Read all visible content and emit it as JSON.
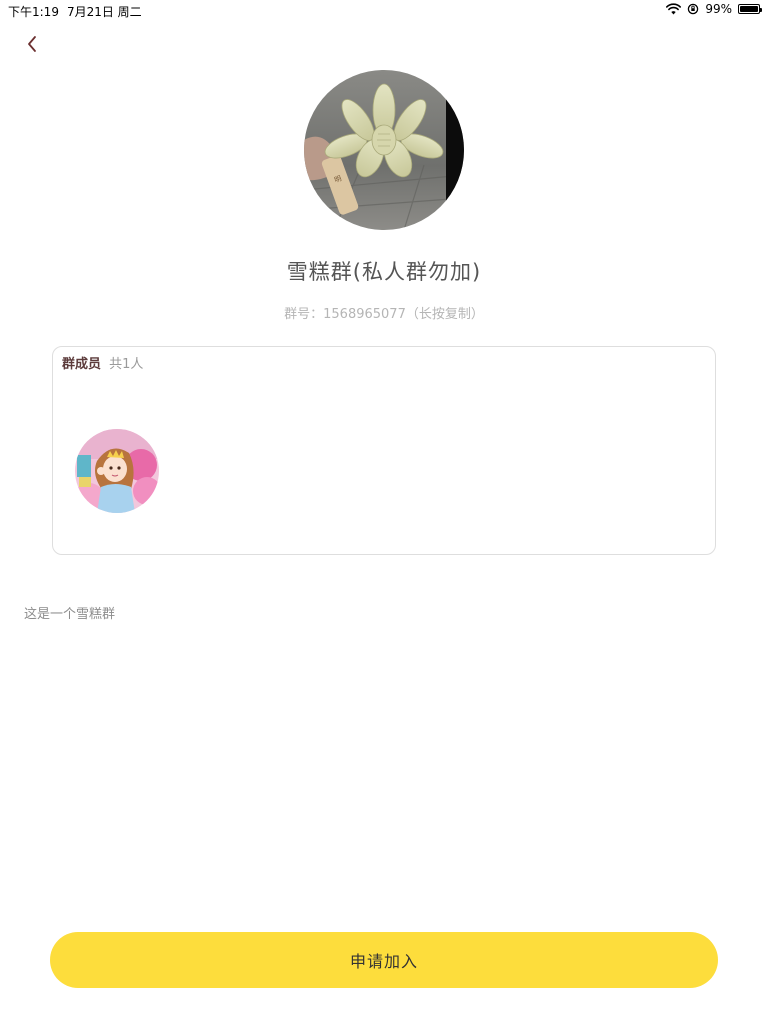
{
  "status_bar": {
    "time": "下午1:19",
    "date": "7月21日 周二",
    "battery_percent": "99%",
    "battery_level": 0.99
  },
  "header": {
    "back_icon": "chevron-left-icon"
  },
  "group": {
    "name": "雪糕群(私人群勿加)",
    "number_line": "群号：1568965077（长按复制）",
    "description": "这是一个雪糕群"
  },
  "members": {
    "title": "群成员",
    "count_label": "共1人"
  },
  "actions": {
    "apply_label": "申请加入"
  },
  "colors": {
    "accent_button": "#fddd3c",
    "back_icon": "#6b2f2f",
    "members_title": "#5c3b3b"
  }
}
